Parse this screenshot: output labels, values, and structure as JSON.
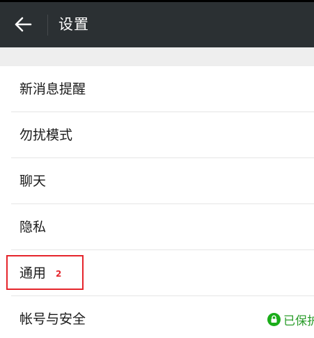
{
  "header": {
    "title": "设置",
    "back_icon": "arrow-left-icon"
  },
  "settings": {
    "items": [
      {
        "label": "新消息提醒"
      },
      {
        "label": "勿扰模式"
      },
      {
        "label": "聊天"
      },
      {
        "label": "隐私"
      },
      {
        "label": "通用",
        "annotation": "2"
      },
      {
        "label": "帐号与安全",
        "status": "已保护",
        "status_icon": "lock-icon"
      }
    ]
  },
  "colors": {
    "app_bar": "#2b3033",
    "highlight": "#e5242b",
    "protected_green": "#1aad19",
    "background_gap": "#eeeeee"
  }
}
